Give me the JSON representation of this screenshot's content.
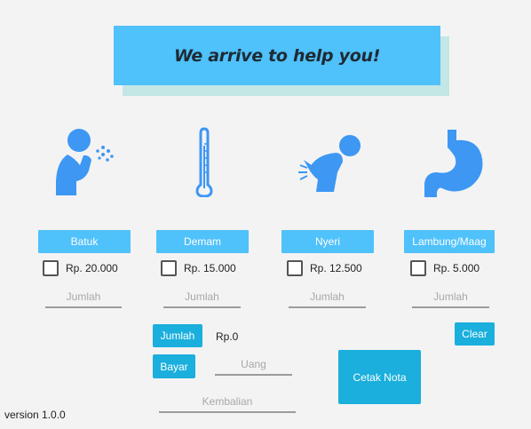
{
  "banner": {
    "title": "We arrive to help you!"
  },
  "items": [
    {
      "label": "Batuk",
      "price": "Rp. 20.000",
      "qty_placeholder": "Jumlah",
      "icon": "coughing-person-icon"
    },
    {
      "label": "Demam",
      "price": "Rp. 15.000",
      "qty_placeholder": "Jumlah",
      "icon": "thermometer-icon"
    },
    {
      "label": "Nyeri",
      "price": "Rp. 12.500",
      "qty_placeholder": "Jumlah",
      "icon": "back-pain-icon"
    },
    {
      "label": "Lambung/Maag",
      "price": "Rp. 5.000",
      "qty_placeholder": "Jumlah",
      "icon": "stomach-icon"
    }
  ],
  "actions": {
    "jumlah_label": "Jumlah",
    "total_value": "Rp.0",
    "bayar_label": "Bayar",
    "uang_placeholder": "Uang",
    "kembalian_placeholder": "Kembalian",
    "cetak_label": "Cetak Nota",
    "clear_label": "Clear"
  },
  "footer": {
    "version": "version 1.0.0"
  },
  "colors": {
    "accent": "#4fc1fb",
    "button": "#1aafdc",
    "icon": "#3d97f3",
    "banner_shadow": "#c3e7e4"
  }
}
